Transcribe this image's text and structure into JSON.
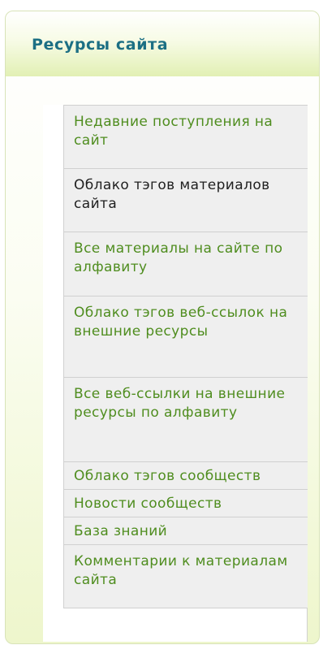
{
  "block": {
    "title": "Ресурсы сайта"
  },
  "menu": {
    "items": [
      {
        "label": "Недавние поступления на сайт",
        "active": false
      },
      {
        "label": "Облако тэгов материалов сайта",
        "active": true
      },
      {
        "label": "Все материалы на сайте по алфавиту",
        "active": false
      },
      {
        "label": "Облако тэгов веб-ссылок на внешние ресурсы",
        "active": false
      },
      {
        "label": "Все веб-ссылки на внешние ресурсы по алфавиту",
        "active": false
      },
      {
        "label": "Облако тэгов сообществ",
        "active": false
      },
      {
        "label": "Новости сообществ",
        "active": false
      },
      {
        "label": "База знаний",
        "active": false
      },
      {
        "label": "Комментарии к материалам сайта",
        "active": false
      }
    ]
  },
  "colors": {
    "title": "#1c6f84",
    "link": "#4f8d1f",
    "active_link": "#1f1f1f",
    "item_background": "#efefef"
  }
}
